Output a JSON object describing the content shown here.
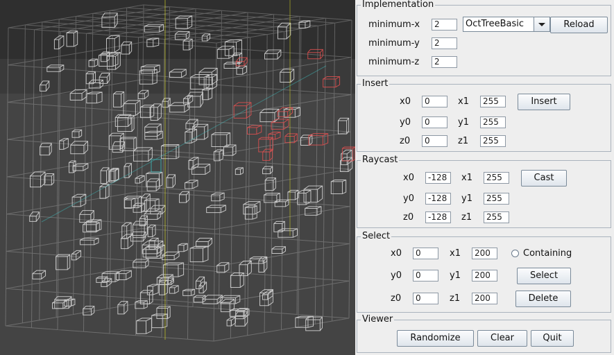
{
  "viewport": {
    "background": "#444444",
    "box_color": "#e6e6e6",
    "highlight_color": "#e05050",
    "ray_color": "#40c0c0",
    "axis_color": "#e0e020"
  },
  "implementation": {
    "title": "Implementation",
    "min_x_label": "minimum-x",
    "min_x_value": "2",
    "min_y_label": "minimum-y",
    "min_y_value": "2",
    "min_z_label": "minimum-z",
    "min_z_value": "2",
    "type_selected": "OctTreeBasic",
    "reload_label": "Reload"
  },
  "insert": {
    "title": "Insert",
    "x0_label": "x0",
    "x0_value": "0",
    "x1_label": "x1",
    "x1_value": "255",
    "y0_label": "y0",
    "y0_value": "0",
    "y1_label": "y1",
    "y1_value": "255",
    "z0_label": "z0",
    "z0_value": "0",
    "z1_label": "z1",
    "z1_value": "255",
    "button_label": "Insert"
  },
  "raycast": {
    "title": "Raycast",
    "x0_label": "x0",
    "x0_value": "-128",
    "x1_label": "x1",
    "x1_value": "255",
    "y0_label": "y0",
    "y0_value": "-128",
    "y1_label": "y1",
    "y1_value": "255",
    "z0_label": "z0",
    "z0_value": "-128",
    "z1_label": "z1",
    "z1_value": "255",
    "button_label": "Cast"
  },
  "select": {
    "title": "Select",
    "x0_label": "x0",
    "x0_value": "0",
    "x1_label": "x1",
    "x1_value": "200",
    "y0_label": "y0",
    "y0_value": "0",
    "y1_label": "y1",
    "y1_value": "200",
    "z0_label": "z0",
    "z0_value": "0",
    "z1_label": "z1",
    "z1_value": "200",
    "containing_label": "Containing",
    "select_label": "Select",
    "delete_label": "Delete"
  },
  "viewer": {
    "title": "Viewer",
    "randomize_label": "Randomize",
    "clear_label": "Clear",
    "quit_label": "Quit"
  }
}
